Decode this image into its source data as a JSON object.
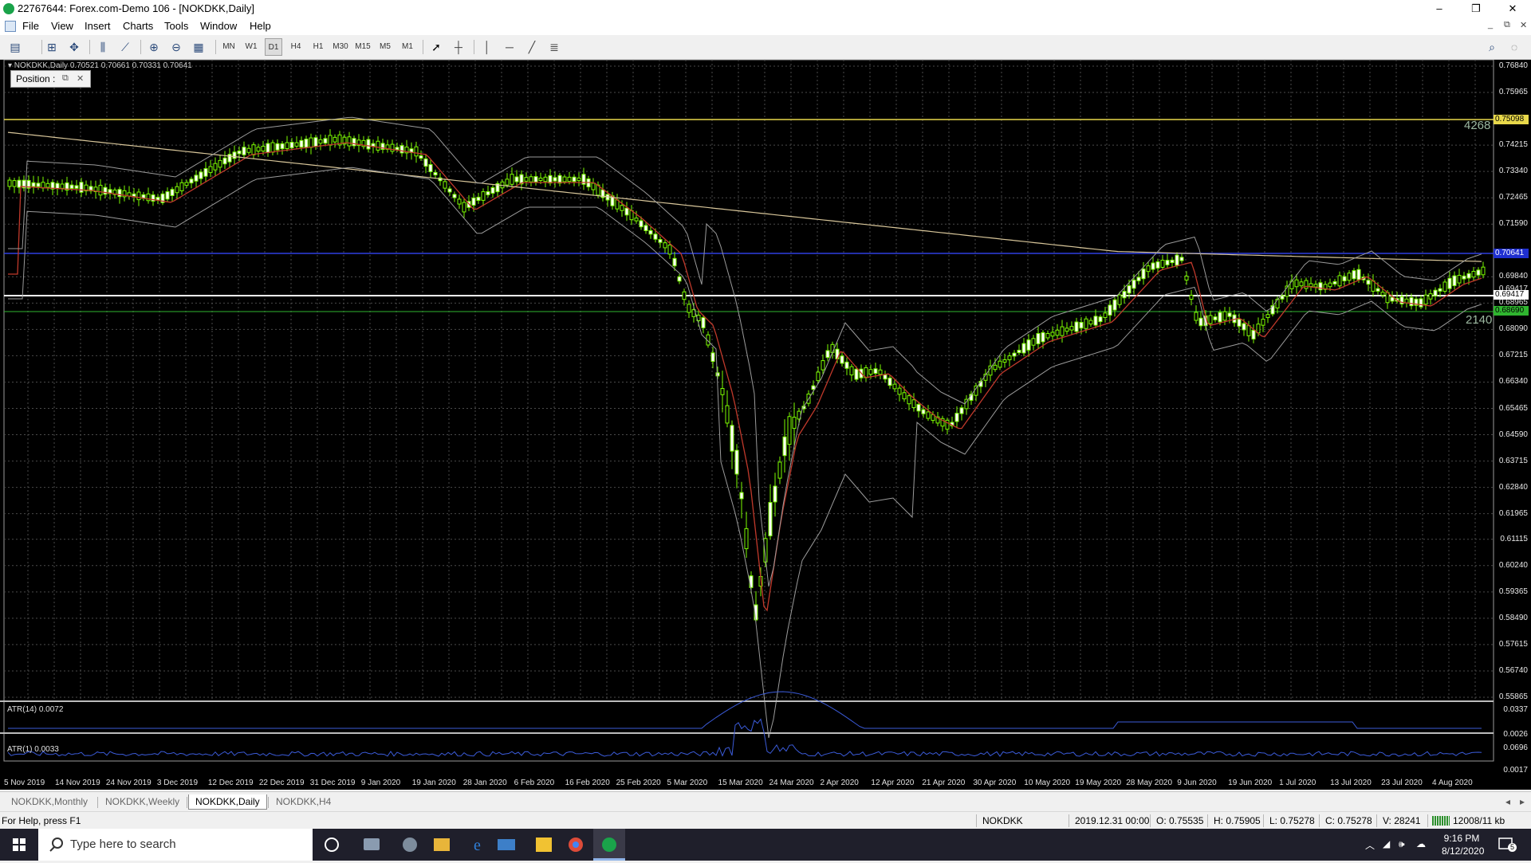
{
  "window": {
    "title": "22767644: Forex.com-Demo 106 - [NOKDKK,Daily]",
    "controls": [
      "–",
      "❐",
      "✕"
    ]
  },
  "menu": [
    "File",
    "View",
    "Insert",
    "Charts",
    "Tools",
    "Window",
    "Help"
  ],
  "mdi_controls": [
    "_",
    "⧉",
    "✕"
  ],
  "toolbar": {
    "timeframes": [
      "MN",
      "W1",
      "D1",
      "H4",
      "H1",
      "M30",
      "M15",
      "M5",
      "M1"
    ],
    "active_timeframe": "D1"
  },
  "chart": {
    "header": "▾ NOKDKK,Daily  0.70521 0.70661 0.70331 0.70641",
    "position_panel": "Position :",
    "price_levels": [
      "0.76840",
      "0.75965",
      "0.75098",
      "0.74215",
      "0.73340",
      "0.72465",
      "0.71590",
      "0.70641",
      "0.69840",
      "0.69417",
      "0.68965",
      "0.68090",
      "0.67215",
      "0.66340",
      "0.65465",
      "0.64590",
      "0.63715",
      "0.62840",
      "0.61965",
      "0.61115",
      "0.60240",
      "0.59365",
      "0.58490",
      "0.57615",
      "0.56740",
      "0.55865"
    ],
    "highlight_labels": {
      "yellow": "0.75098",
      "blue": "0.70641",
      "white": "0.69417",
      "green": "0.68690"
    },
    "big_numbers": {
      "upper": "4268",
      "lower": "2140"
    },
    "indicators": {
      "atr14": {
        "label": "ATR(14) 0.0072",
        "axis_top": "0.0337",
        "axis_bottom": "0.0026"
      },
      "atr1": {
        "label": "ATR(1) 0.0033",
        "axis_top": "0.0696",
        "axis_bottom": "0.0017"
      }
    },
    "date_labels": [
      "5 Nov 2019",
      "14 Nov 2019",
      "24 Nov 2019",
      "3 Dec 2019",
      "12 Dec 2019",
      "22 Dec 2019",
      "31 Dec 2019",
      "9 Jan 2020",
      "19 Jan 2020",
      "28 Jan 2020",
      "6 Feb 2020",
      "16 Feb 2020",
      "25 Feb 2020",
      "5 Mar 2020",
      "15 Mar 2020",
      "24 Mar 2020",
      "2 Apr 2020",
      "12 Apr 2020",
      "21 Apr 2020",
      "30 Apr 2020",
      "10 May 2020",
      "19 May 2020",
      "28 May 2020",
      "9 Jun 2020",
      "19 Jun 2020",
      "1 Jul 2020",
      "13 Jul 2020",
      "23 Jul 2020",
      "4 Aug 2020"
    ],
    "colors": {
      "background": "#000000",
      "grid": "#4a4a4a",
      "candle": "#7cfc00",
      "moving_average_fast": "#c0392b",
      "moving_average_slow": "#d8c69a",
      "bollinger": "#9a9a9a",
      "atr_line": "#3b5bd9"
    }
  },
  "tabs": [
    "NOKDKK,Monthly",
    "NOKDKK,Weekly",
    "NOKDKK,Daily",
    "NOKDKK,H4"
  ],
  "active_tab": "NOKDKK,Daily",
  "status": {
    "help": "For Help, press F1",
    "symbol": "NOKDKK",
    "datetime": "2019.12.31 00:00",
    "open": "O: 0.75535",
    "high": "H: 0.75905",
    "low": "L: 0.75278",
    "close": "C: 0.75278",
    "volume": "V: 28241",
    "traffic": "12008/11 kb"
  },
  "taskbar": {
    "search_placeholder": "Type here to search",
    "time": "9:16 PM",
    "date": "8/12/2020",
    "notification_count": "5"
  }
}
